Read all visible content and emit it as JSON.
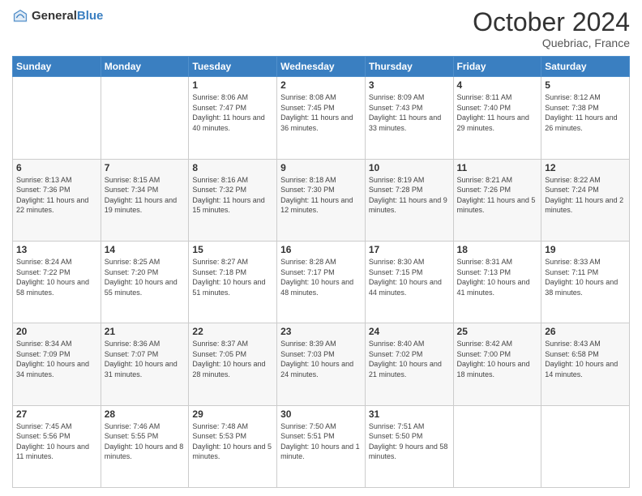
{
  "logo": {
    "general": "General",
    "blue": "Blue"
  },
  "header": {
    "month": "October 2024",
    "location": "Quebriac, France"
  },
  "days_of_week": [
    "Sunday",
    "Monday",
    "Tuesday",
    "Wednesday",
    "Thursday",
    "Friday",
    "Saturday"
  ],
  "weeks": [
    [
      {
        "day": "",
        "sunrise": "",
        "sunset": "",
        "daylight": ""
      },
      {
        "day": "",
        "sunrise": "",
        "sunset": "",
        "daylight": ""
      },
      {
        "day": "1",
        "sunrise": "Sunrise: 8:06 AM",
        "sunset": "Sunset: 7:47 PM",
        "daylight": "Daylight: 11 hours and 40 minutes."
      },
      {
        "day": "2",
        "sunrise": "Sunrise: 8:08 AM",
        "sunset": "Sunset: 7:45 PM",
        "daylight": "Daylight: 11 hours and 36 minutes."
      },
      {
        "day": "3",
        "sunrise": "Sunrise: 8:09 AM",
        "sunset": "Sunset: 7:43 PM",
        "daylight": "Daylight: 11 hours and 33 minutes."
      },
      {
        "day": "4",
        "sunrise": "Sunrise: 8:11 AM",
        "sunset": "Sunset: 7:40 PM",
        "daylight": "Daylight: 11 hours and 29 minutes."
      },
      {
        "day": "5",
        "sunrise": "Sunrise: 8:12 AM",
        "sunset": "Sunset: 7:38 PM",
        "daylight": "Daylight: 11 hours and 26 minutes."
      }
    ],
    [
      {
        "day": "6",
        "sunrise": "Sunrise: 8:13 AM",
        "sunset": "Sunset: 7:36 PM",
        "daylight": "Daylight: 11 hours and 22 minutes."
      },
      {
        "day": "7",
        "sunrise": "Sunrise: 8:15 AM",
        "sunset": "Sunset: 7:34 PM",
        "daylight": "Daylight: 11 hours and 19 minutes."
      },
      {
        "day": "8",
        "sunrise": "Sunrise: 8:16 AM",
        "sunset": "Sunset: 7:32 PM",
        "daylight": "Daylight: 11 hours and 15 minutes."
      },
      {
        "day": "9",
        "sunrise": "Sunrise: 8:18 AM",
        "sunset": "Sunset: 7:30 PM",
        "daylight": "Daylight: 11 hours and 12 minutes."
      },
      {
        "day": "10",
        "sunrise": "Sunrise: 8:19 AM",
        "sunset": "Sunset: 7:28 PM",
        "daylight": "Daylight: 11 hours and 9 minutes."
      },
      {
        "day": "11",
        "sunrise": "Sunrise: 8:21 AM",
        "sunset": "Sunset: 7:26 PM",
        "daylight": "Daylight: 11 hours and 5 minutes."
      },
      {
        "day": "12",
        "sunrise": "Sunrise: 8:22 AM",
        "sunset": "Sunset: 7:24 PM",
        "daylight": "Daylight: 11 hours and 2 minutes."
      }
    ],
    [
      {
        "day": "13",
        "sunrise": "Sunrise: 8:24 AM",
        "sunset": "Sunset: 7:22 PM",
        "daylight": "Daylight: 10 hours and 58 minutes."
      },
      {
        "day": "14",
        "sunrise": "Sunrise: 8:25 AM",
        "sunset": "Sunset: 7:20 PM",
        "daylight": "Daylight: 10 hours and 55 minutes."
      },
      {
        "day": "15",
        "sunrise": "Sunrise: 8:27 AM",
        "sunset": "Sunset: 7:18 PM",
        "daylight": "Daylight: 10 hours and 51 minutes."
      },
      {
        "day": "16",
        "sunrise": "Sunrise: 8:28 AM",
        "sunset": "Sunset: 7:17 PM",
        "daylight": "Daylight: 10 hours and 48 minutes."
      },
      {
        "day": "17",
        "sunrise": "Sunrise: 8:30 AM",
        "sunset": "Sunset: 7:15 PM",
        "daylight": "Daylight: 10 hours and 44 minutes."
      },
      {
        "day": "18",
        "sunrise": "Sunrise: 8:31 AM",
        "sunset": "Sunset: 7:13 PM",
        "daylight": "Daylight: 10 hours and 41 minutes."
      },
      {
        "day": "19",
        "sunrise": "Sunrise: 8:33 AM",
        "sunset": "Sunset: 7:11 PM",
        "daylight": "Daylight: 10 hours and 38 minutes."
      }
    ],
    [
      {
        "day": "20",
        "sunrise": "Sunrise: 8:34 AM",
        "sunset": "Sunset: 7:09 PM",
        "daylight": "Daylight: 10 hours and 34 minutes."
      },
      {
        "day": "21",
        "sunrise": "Sunrise: 8:36 AM",
        "sunset": "Sunset: 7:07 PM",
        "daylight": "Daylight: 10 hours and 31 minutes."
      },
      {
        "day": "22",
        "sunrise": "Sunrise: 8:37 AM",
        "sunset": "Sunset: 7:05 PM",
        "daylight": "Daylight: 10 hours and 28 minutes."
      },
      {
        "day": "23",
        "sunrise": "Sunrise: 8:39 AM",
        "sunset": "Sunset: 7:03 PM",
        "daylight": "Daylight: 10 hours and 24 minutes."
      },
      {
        "day": "24",
        "sunrise": "Sunrise: 8:40 AM",
        "sunset": "Sunset: 7:02 PM",
        "daylight": "Daylight: 10 hours and 21 minutes."
      },
      {
        "day": "25",
        "sunrise": "Sunrise: 8:42 AM",
        "sunset": "Sunset: 7:00 PM",
        "daylight": "Daylight: 10 hours and 18 minutes."
      },
      {
        "day": "26",
        "sunrise": "Sunrise: 8:43 AM",
        "sunset": "Sunset: 6:58 PM",
        "daylight": "Daylight: 10 hours and 14 minutes."
      }
    ],
    [
      {
        "day": "27",
        "sunrise": "Sunrise: 7:45 AM",
        "sunset": "Sunset: 5:56 PM",
        "daylight": "Daylight: 10 hours and 11 minutes."
      },
      {
        "day": "28",
        "sunrise": "Sunrise: 7:46 AM",
        "sunset": "Sunset: 5:55 PM",
        "daylight": "Daylight: 10 hours and 8 minutes."
      },
      {
        "day": "29",
        "sunrise": "Sunrise: 7:48 AM",
        "sunset": "Sunset: 5:53 PM",
        "daylight": "Daylight: 10 hours and 5 minutes."
      },
      {
        "day": "30",
        "sunrise": "Sunrise: 7:50 AM",
        "sunset": "Sunset: 5:51 PM",
        "daylight": "Daylight: 10 hours and 1 minute."
      },
      {
        "day": "31",
        "sunrise": "Sunrise: 7:51 AM",
        "sunset": "Sunset: 5:50 PM",
        "daylight": "Daylight: 9 hours and 58 minutes."
      },
      {
        "day": "",
        "sunrise": "",
        "sunset": "",
        "daylight": ""
      },
      {
        "day": "",
        "sunrise": "",
        "sunset": "",
        "daylight": ""
      }
    ]
  ]
}
